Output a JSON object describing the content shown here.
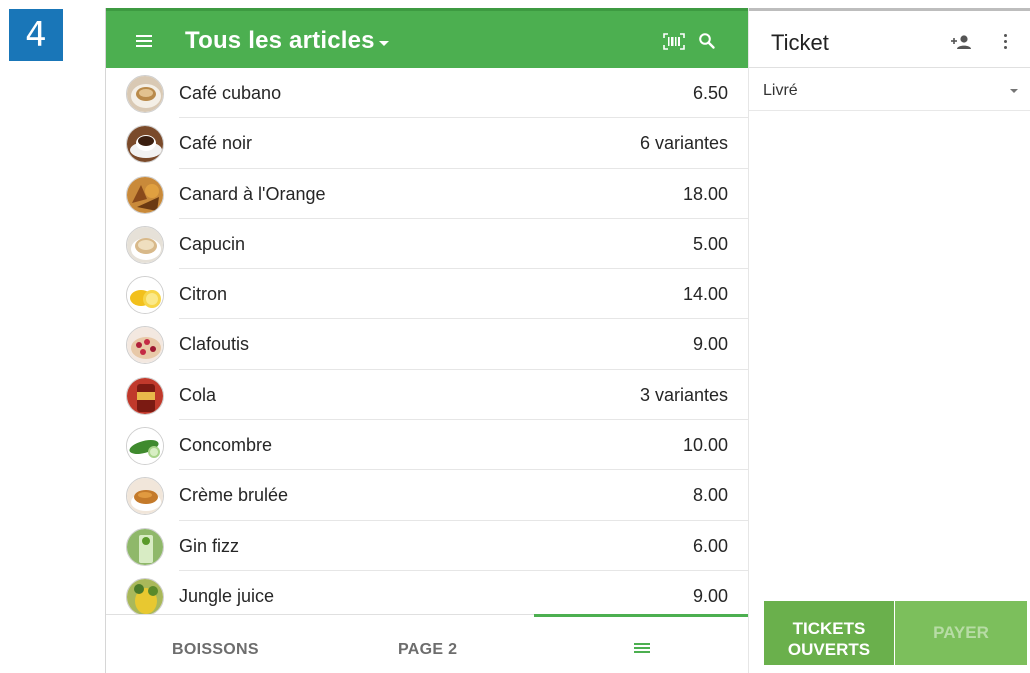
{
  "step_badge": "4",
  "header": {
    "title": "Tous les articles",
    "barcode_icon": "barcode-scan-icon",
    "search_icon": "search-icon",
    "menu_icon": "hamburger-menu-icon"
  },
  "colors": {
    "accent": "#4caf50",
    "button": "#6ab04c",
    "badge": "#1976b8"
  },
  "items": [
    {
      "name": "Café cubano",
      "price": "6.50",
      "thumb": "coffee-cup"
    },
    {
      "name": "Café noir",
      "price": "6 variantes",
      "thumb": "black-coffee"
    },
    {
      "name": "Canard à l'Orange",
      "price": "18.00",
      "thumb": "duck-dish"
    },
    {
      "name": "Capucin",
      "price": "5.00",
      "thumb": "cappuccino"
    },
    {
      "name": "Citron",
      "price": "14.00",
      "thumb": "lemon"
    },
    {
      "name": "Clafoutis",
      "price": "9.00",
      "thumb": "clafoutis"
    },
    {
      "name": "Cola",
      "price": "3 variantes",
      "thumb": "cola"
    },
    {
      "name": "Concombre",
      "price": "10.00",
      "thumb": "cucumber"
    },
    {
      "name": "Crème brulée",
      "price": "8.00",
      "thumb": "creme-brulee"
    },
    {
      "name": "Gin fizz",
      "price": "6.00",
      "thumb": "gin-fizz"
    },
    {
      "name": "Jungle juice",
      "price": "9.00",
      "thumb": "jungle-juice"
    }
  ],
  "bottom_tabs": {
    "tab1": "BOISSONS",
    "tab2": "PAGE 2",
    "tab3_icon": "list-icon",
    "active": "tab3"
  },
  "ticket": {
    "title": "Ticket",
    "dining_option": "Livré",
    "add_customer_icon": "add-customer-icon",
    "more_icon": "more-vertical-icon",
    "open_tickets_label_line1": "TICKETS",
    "open_tickets_label_line2": "OUVERTS",
    "pay_label": "PAYER"
  }
}
